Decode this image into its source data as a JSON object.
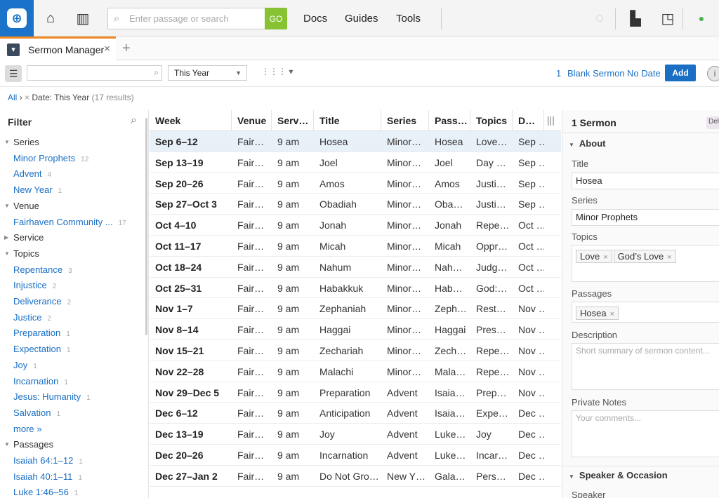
{
  "topbar": {
    "search_placeholder": "Enter passage or search",
    "go_label": "GO",
    "nav": [
      "Docs",
      "Guides",
      "Tools"
    ]
  },
  "tab": {
    "label": "Sermon Manager",
    "close": "×",
    "add": "+"
  },
  "toolbar": {
    "range": "This Year",
    "count": "1",
    "blank_sermon": "Blank Sermon",
    "no_date": "No Date",
    "add": "Add"
  },
  "breadcrumb": {
    "all": "All",
    "sep": "›",
    "remove": "×",
    "filter": "Date: This Year",
    "count": "(17 results)"
  },
  "filter": {
    "title": "Filter",
    "rows": [
      {
        "kind": "group",
        "label": "Series"
      },
      {
        "kind": "item",
        "label": "Minor Prophets",
        "count": "12"
      },
      {
        "kind": "item",
        "label": "Advent",
        "count": "4"
      },
      {
        "kind": "item",
        "label": "New Year",
        "count": "1"
      },
      {
        "kind": "group",
        "label": "Venue"
      },
      {
        "kind": "item",
        "label": "Fairhaven Community ...",
        "count": "17"
      },
      {
        "kind": "group",
        "label": "Service",
        "collapsed": true
      },
      {
        "kind": "group",
        "label": "Topics"
      },
      {
        "kind": "item",
        "label": "Repentance",
        "count": "3"
      },
      {
        "kind": "item",
        "label": "Injustice",
        "count": "2"
      },
      {
        "kind": "item",
        "label": "Deliverance",
        "count": "2"
      },
      {
        "kind": "item",
        "label": "Justice",
        "count": "2"
      },
      {
        "kind": "item",
        "label": "Preparation",
        "count": "1"
      },
      {
        "kind": "item",
        "label": "Expectation",
        "count": "1"
      },
      {
        "kind": "item",
        "label": "Joy",
        "count": "1"
      },
      {
        "kind": "item",
        "label": "Incarnation",
        "count": "1"
      },
      {
        "kind": "item",
        "label": "Jesus: Humanity",
        "count": "1"
      },
      {
        "kind": "item",
        "label": "Salvation",
        "count": "1"
      },
      {
        "kind": "item",
        "label": "more »",
        "count": ""
      },
      {
        "kind": "group",
        "label": "Passages"
      },
      {
        "kind": "item",
        "label": "Isaiah 64:1–12",
        "count": "1"
      },
      {
        "kind": "item",
        "label": "Isaiah 40:1–11",
        "count": "1"
      },
      {
        "kind": "item",
        "label": "Luke 1:46–56",
        "count": "1"
      }
    ]
  },
  "table": {
    "headers": [
      "Week",
      "Venue",
      "Serv…",
      "Title",
      "Series",
      "Pass…",
      "Topics",
      "D…"
    ],
    "rows": [
      [
        "Sep 6–12",
        "Fair…",
        "9 am",
        "Hosea",
        "Minor…",
        "Hosea",
        "Love…",
        "Sep …"
      ],
      [
        "Sep 13–19",
        "Fair…",
        "9 am",
        "Joel",
        "Minor…",
        "Joel",
        "Day …",
        "Sep …"
      ],
      [
        "Sep 20–26",
        "Fair…",
        "9 am",
        "Amos",
        "Minor…",
        "Amos",
        "Justi…",
        "Sep …"
      ],
      [
        "Sep 27–Oct 3",
        "Fair…",
        "9 am",
        "Obadiah",
        "Minor…",
        "Oba…",
        "Justi…",
        "Sep …"
      ],
      [
        "Oct 4–10",
        "Fair…",
        "9 am",
        "Jonah",
        "Minor…",
        "Jonah",
        "Repe…",
        "Oct …"
      ],
      [
        "Oct 11–17",
        "Fair…",
        "9 am",
        "Micah",
        "Minor…",
        "Micah",
        "Oppr…",
        "Oct …"
      ],
      [
        "Oct 18–24",
        "Fair…",
        "9 am",
        "Nahum",
        "Minor…",
        "Nah…",
        "Judg…",
        "Oct …"
      ],
      [
        "Oct 25–31",
        "Fair…",
        "9 am",
        "Habakkuk",
        "Minor…",
        "Hab…",
        "God:…",
        "Oct …"
      ],
      [
        "Nov 1–7",
        "Fair…",
        "9 am",
        "Zephaniah",
        "Minor…",
        "Zeph…",
        "Rest…",
        "Nov …"
      ],
      [
        "Nov 8–14",
        "Fair…",
        "9 am",
        "Haggai",
        "Minor…",
        "Haggai",
        "Pres…",
        "Nov …"
      ],
      [
        "Nov 15–21",
        "Fair…",
        "9 am",
        "Zechariah",
        "Minor…",
        "Zech…",
        "Repe…",
        "Nov …"
      ],
      [
        "Nov 22–28",
        "Fair…",
        "9 am",
        "Malachi",
        "Minor…",
        "Mala…",
        "Repe…",
        "Nov …"
      ],
      [
        "Nov 29–Dec 5",
        "Fair…",
        "9 am",
        "Preparation",
        "Advent",
        "Isaia…",
        "Prep…",
        "Nov …"
      ],
      [
        "Dec 6–12",
        "Fair…",
        "9 am",
        "Anticipation",
        "Advent",
        "Isaia…",
        "Expe…",
        "Dec …"
      ],
      [
        "Dec 13–19",
        "Fair…",
        "9 am",
        "Joy",
        "Advent",
        "Luke…",
        "Joy",
        "Dec …"
      ],
      [
        "Dec 20–26",
        "Fair…",
        "9 am",
        "Incarnation",
        "Advent",
        "Luke…",
        "Incar…",
        "Dec …"
      ],
      [
        "Dec 27–Jan 2",
        "Fair…",
        "9 am",
        "Do Not Gro…",
        "New Y…",
        "Gala…",
        "Pers…",
        "Dec …"
      ]
    ]
  },
  "detail": {
    "title": "1 Sermon",
    "delete": "Del",
    "about": "About",
    "title_label": "Title",
    "title_value": "Hosea",
    "series_label": "Series",
    "series_value": "Minor Prophets",
    "topics_label": "Topics",
    "topics": [
      "Love",
      "God’s Love"
    ],
    "passages_label": "Passages",
    "passages": [
      "Hosea"
    ],
    "description_label": "Description",
    "description_placeholder": "Short summary of sermon content...",
    "notes_label": "Private Notes",
    "notes_placeholder": "Your comments...",
    "speaker_section": "Speaker & Occasion",
    "speaker_label": "Speaker"
  },
  "colors": {
    "accent": "#1a6fc4",
    "go": "#86c232",
    "logo": "#1a73c8",
    "tab_accent": "#f08a24"
  }
}
